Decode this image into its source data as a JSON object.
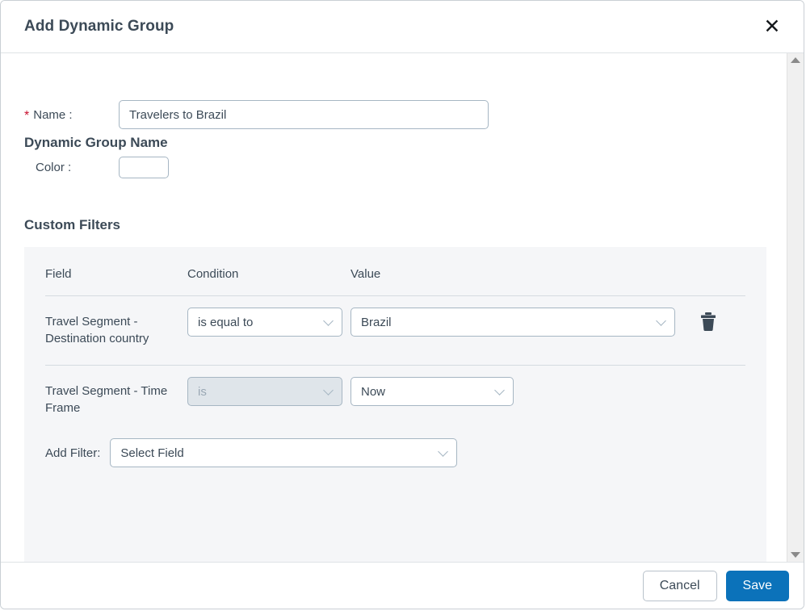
{
  "dialog": {
    "title": "Add Dynamic Group",
    "close_icon": "close-icon"
  },
  "name_section": {
    "heading": "Dynamic Group Name",
    "name_label": "Name :",
    "required_marker": "*",
    "name_value": "Travelers to Brazil",
    "name_placeholder": "",
    "color_label": "Color :",
    "color_value": "#ffffff"
  },
  "filters_section": {
    "heading": "Custom Filters",
    "columns": {
      "field": "Field",
      "condition": "Condition",
      "value": "Value"
    },
    "rows": [
      {
        "field": "Travel Segment - Destination country",
        "condition": "is equal to",
        "value": "Brazil",
        "condition_disabled": false,
        "delete_icon": "trash-icon"
      },
      {
        "field": "Travel Segment - Time Frame",
        "condition": "is",
        "value": "Now",
        "condition_disabled": true,
        "delete_icon": ""
      }
    ],
    "add_filter_label": "Add Filter:",
    "add_filter_value": "Select Field"
  },
  "footer": {
    "cancel_label": "Cancel",
    "save_label": "Save"
  },
  "scrollbar": {
    "up_icon": "scroll-up-arrow-icon",
    "down_icon": "scroll-down-arrow-icon"
  },
  "colors": {
    "accent": "#0b72ba",
    "required": "#c8102e",
    "text": "#3c4a57",
    "panel_bg": "#f5f6f8",
    "border": "#a6b6c3",
    "disabled_bg": "#dfe5ea"
  }
}
